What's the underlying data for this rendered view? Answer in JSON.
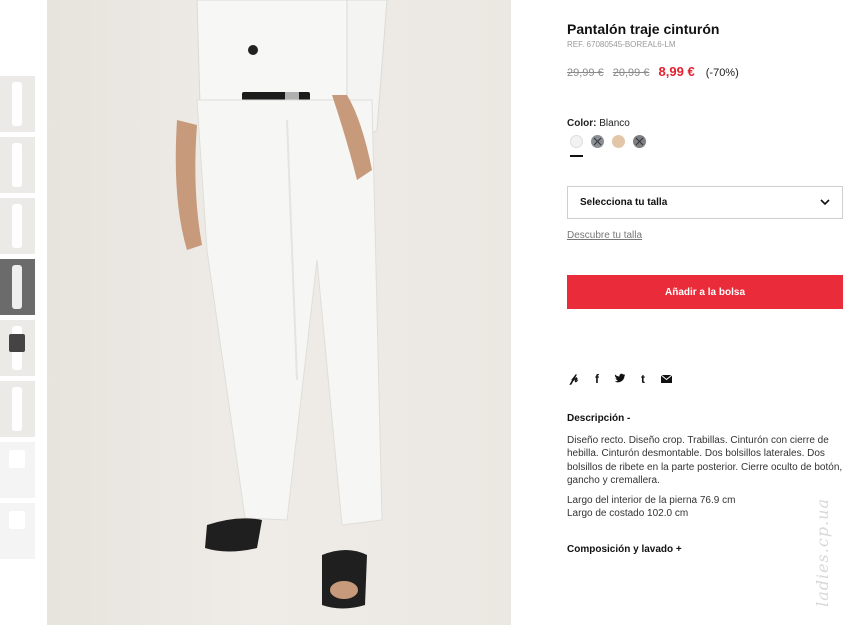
{
  "product": {
    "title": "Pantalón traje cinturón",
    "ref": "REF. 67080545-BOREAL6-LM",
    "prices": {
      "original_1": "29,99 €",
      "original_2": "20,99 €",
      "sale": "8,99 €",
      "discount": "(-70%)"
    }
  },
  "color": {
    "label": "Color:",
    "selected": "Blanco",
    "swatches": [
      {
        "name": "white-swatch",
        "hex": "#f2f2f2"
      },
      {
        "name": "grey-swatch",
        "hex": "#8a8f96"
      },
      {
        "name": "beige-swatch",
        "hex": "#e2c6a7"
      },
      {
        "name": "darkgrey-swatch",
        "hex": "#7d7f82"
      }
    ]
  },
  "size": {
    "select_label": "Selecciona tu talla",
    "guide_link": "Descubre tu talla"
  },
  "cart": {
    "add_label": "Añadir a la bolsa"
  },
  "share": {
    "icons": [
      "pinterest-icon",
      "facebook-icon",
      "twitter-icon",
      "tumblr-icon",
      "email-icon"
    ]
  },
  "description": {
    "heading": "Descripción  -",
    "body": "Diseño recto. Diseño crop. Trabillas. Cinturón con cierre de hebilla. Cinturón desmontable. Dos bolsillos laterales. Dos bolsillos de ribete en la parte posterior. Cierre oculto de botón, gancho y cremallera.",
    "measure_1": "Largo del interior de la pierna 76.9 cm",
    "measure_2": "Largo de costado 102.0 cm"
  },
  "composition": {
    "heading": "Composición y lavado  +"
  },
  "watermark": "ladies.cp.ua",
  "colors": {
    "accent": "#ea2b39",
    "sale_price": "#e4202d"
  }
}
